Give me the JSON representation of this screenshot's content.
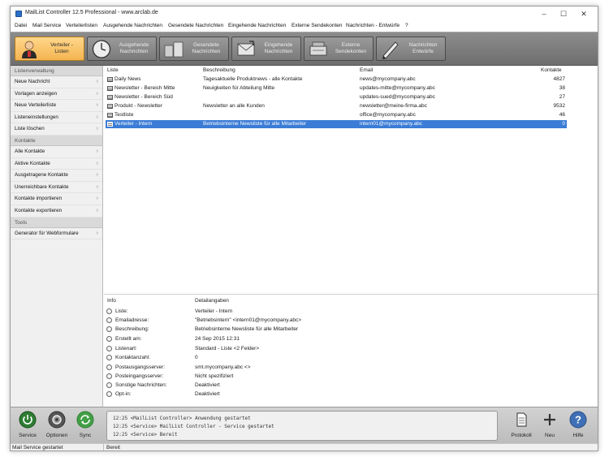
{
  "window": {
    "title": "MailList Controller 12.5 Professional - www.arclab.de"
  },
  "menu": [
    "Datei",
    "Mail Service",
    "Verteilerlisten",
    "Ausgehende Nachrichten",
    "Gesendete Nachrichten",
    "Eingehende Nachrichten",
    "Externe Sendekonten",
    "Nachrichten - Entwürfe",
    "?"
  ],
  "toolbar": [
    {
      "label": "Verteiler -\nListen",
      "icon": "users-icon",
      "active": true
    },
    {
      "label": "Ausgehende\nNachrichten",
      "icon": "clock-icon",
      "active": false
    },
    {
      "label": "Gesendete\nNachrichten",
      "icon": "outbox-icon",
      "active": false
    },
    {
      "label": "Eingehende\nNachrichten",
      "icon": "inbox-icon",
      "active": false
    },
    {
      "label": "Externe\nSendekonten",
      "icon": "server-icon",
      "active": false
    },
    {
      "label": "Nachrichten\nEntwürfe",
      "icon": "pen-icon",
      "active": false
    }
  ],
  "sidebar": {
    "sections": [
      {
        "title": "Listenverwaltung",
        "items": [
          "Neue Nachricht",
          "Vorlagen anzeigen",
          "Neue Verteilerliste",
          "Listeneinstellungen",
          "Liste löschen"
        ]
      },
      {
        "title": "Kontakte",
        "items": [
          "Alle Kontakte",
          "Aktive Kontakte",
          "Ausgetragene Kontakte",
          "Unerreichbare Kontakte",
          "Kontakte importieren",
          "Kontakte exportieren"
        ]
      },
      {
        "title": "Tools",
        "items": [
          "Generator für Webformulare"
        ]
      }
    ],
    "arrow": "›"
  },
  "list": {
    "headers": {
      "liste": "Liste",
      "beschreibung": "Beschreibung",
      "email": "Email",
      "kontakte": "Kontakte"
    },
    "rows": [
      {
        "liste": "Daily News",
        "beschreibung": "Tagesaktuelle Produktnews - alle Kontakte",
        "email": "news@mycompany.abc",
        "kontakte": "4827"
      },
      {
        "liste": "Newsletter - Bereich Mitte",
        "beschreibung": "Neuigkeiten für Abteilung Mitte",
        "email": "updates-mitte@mycompany.abc",
        "kontakte": "38"
      },
      {
        "liste": "Newsletter - Bereich Süd",
        "beschreibung": "",
        "email": "updates-sued@mycompany.abc",
        "kontakte": "27"
      },
      {
        "liste": "Produkt - Newsletter",
        "beschreibung": "Newsletter an alle Kunden",
        "email": "newsletter@meine-firma.abc",
        "kontakte": "9532"
      },
      {
        "liste": "Testliste",
        "beschreibung": "",
        "email": "office@mycompany.abc",
        "kontakte": "46"
      },
      {
        "liste": "Verteiler - Intern",
        "beschreibung": "Betriebsinterne Newsliste für alle Mitarbeiter",
        "email": "intern01@mycompany.abc",
        "kontakte": "0",
        "selected": true
      }
    ]
  },
  "details": {
    "headers": {
      "info": "Info",
      "detail": "Detailangaben"
    },
    "rows": [
      {
        "label": "Liste:",
        "value": "Verteiler - Intern"
      },
      {
        "label": "Emailadresse:",
        "value": "\"Betriebsintern\" <intern01@mycompany.abc>"
      },
      {
        "label": "Beschreibung:",
        "value": "Betriebsinterne Newsliste für alle Mitarbeiter"
      },
      {
        "label": "Erstellt am:",
        "value": "24 Sep 2015 12:31"
      },
      {
        "label": "Listenart:",
        "value": "Standard - Liste <2 Felder>"
      },
      {
        "label": "Kontaktanzahl:",
        "value": "0"
      },
      {
        "label": "Postausgangsserver:",
        "value": "smt.mycompany.abc <>"
      },
      {
        "label": "Posteingangsserver:",
        "value": "Nicht spezifiziert"
      },
      {
        "label": "Sonstige Nachrichten:",
        "value": "Deaktiviert"
      },
      {
        "label": "Opt-in:",
        "value": "Deaktiviert"
      }
    ]
  },
  "bottom": {
    "left_buttons": [
      {
        "label": "Service",
        "icon": "power-icon"
      },
      {
        "label": "Optionen",
        "icon": "settings-icon"
      },
      {
        "label": "Sync",
        "icon": "sync-icon"
      }
    ],
    "log": [
      "12:25 <MailList Controller> Anwendung gestartet",
      "12:25 <Service> MailList Controller - Service gestartet",
      "12:25 <Service> Bereit"
    ],
    "right_buttons": [
      {
        "label": "Protokoll",
        "icon": "document-icon"
      },
      {
        "label": "Neu",
        "icon": "plus-icon"
      },
      {
        "label": "Hilfe",
        "icon": "help-icon"
      }
    ]
  },
  "status": {
    "left": "Mail Service gestartet",
    "right": "Bereit"
  },
  "colors": {
    "selection": "#3b7cd6",
    "toolbar_active": "#f3b451",
    "toolbar_bg": "#7a7a7a"
  }
}
